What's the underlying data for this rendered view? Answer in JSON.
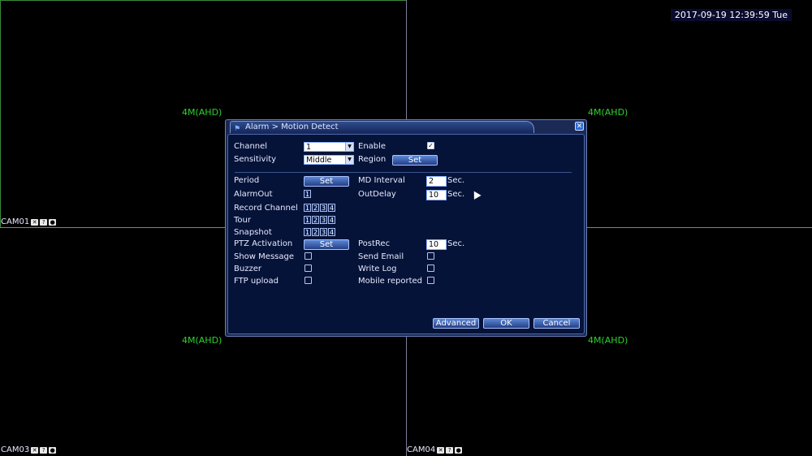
{
  "datetime": "2017-09-19 12:39:59 Tue",
  "cameras": [
    {
      "name": "CAM01",
      "resolution": "4M(AHD)"
    },
    {
      "name": "",
      "resolution": "4M(AHD)"
    },
    {
      "name": "CAM03",
      "resolution": "4M(AHD)"
    },
    {
      "name": "CAM04",
      "resolution": "4M(AHD)"
    }
  ],
  "dialog": {
    "title": "Alarm > Motion Detect",
    "close_symbol": "✕",
    "channel_label": "Channel",
    "channel_value": "1",
    "enable_label": "Enable",
    "enable_checked": true,
    "sensitivity_label": "Sensitivity",
    "sensitivity_value": "Middle",
    "region_label": "Region",
    "set_label": "Set",
    "period_label": "Period",
    "md_interval_label": "MD Interval",
    "md_interval_value": "2",
    "sec_label": "Sec.",
    "alarmout_label": "AlarmOut",
    "alarmout_channels": [
      "1"
    ],
    "outdelay_label": "OutDelay",
    "outdelay_value": "10",
    "record_channel_label": "Record Channel",
    "record_channels": [
      "1",
      "2",
      "3",
      "4"
    ],
    "tour_label": "Tour",
    "tour_channels": [
      "1",
      "2",
      "3",
      "4"
    ],
    "snapshot_label": "Snapshot",
    "snapshot_channels": [
      "1",
      "2",
      "3",
      "4"
    ],
    "ptz_label": "PTZ Activation",
    "postrec_label": "PostRec",
    "postrec_value": "10",
    "show_message_label": "Show Message",
    "send_email_label": "Send Email",
    "buzzer_label": "Buzzer",
    "write_log_label": "Write Log",
    "ftp_upload_label": "FTP upload",
    "mobile_reported_label": "Mobile reported",
    "advanced_label": "Advanced",
    "ok_label": "OK",
    "cancel_label": "Cancel"
  }
}
